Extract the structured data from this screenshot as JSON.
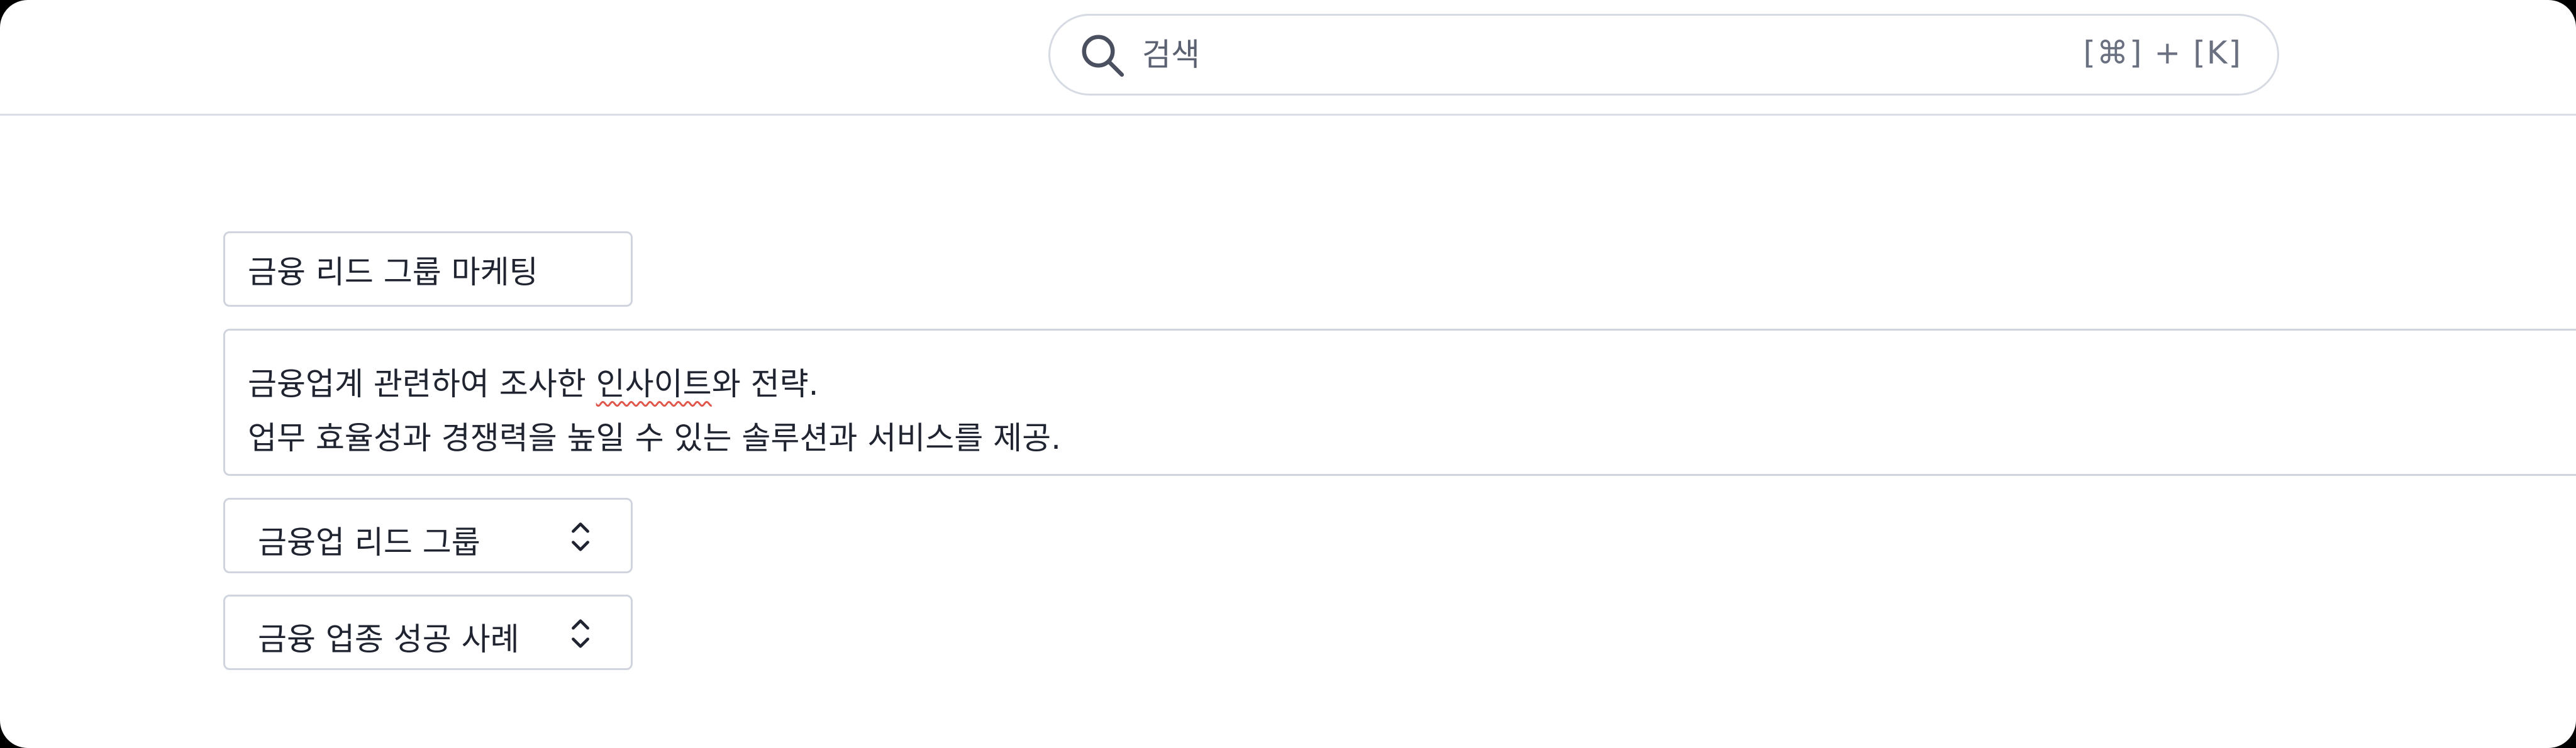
{
  "search": {
    "placeholder": "검색",
    "shortcut": "[⌘] + [K]",
    "icon": "search-icon"
  },
  "form": {
    "title_value": "금융 리드 그룹 마케팅",
    "description": {
      "line1_before": "금융업계 관련하여 조사한 ",
      "line1_marked": "인사이트",
      "line1_after": "와 전략.",
      "line2": "업무 효율성과 경쟁력을 높일 수 있는 솔루션과 서비스를 제공."
    },
    "select_group": {
      "value": "금융업 리드 그룹",
      "icon": "chevron-up-down-icon"
    },
    "select_case": {
      "value": "금융 업종 성공 사례",
      "icon": "chevron-up-down-icon"
    }
  },
  "colors": {
    "border": "#cfd4de",
    "text": "#1f2430",
    "muted": "#5b6170",
    "spellcheck": "#e0564a"
  }
}
